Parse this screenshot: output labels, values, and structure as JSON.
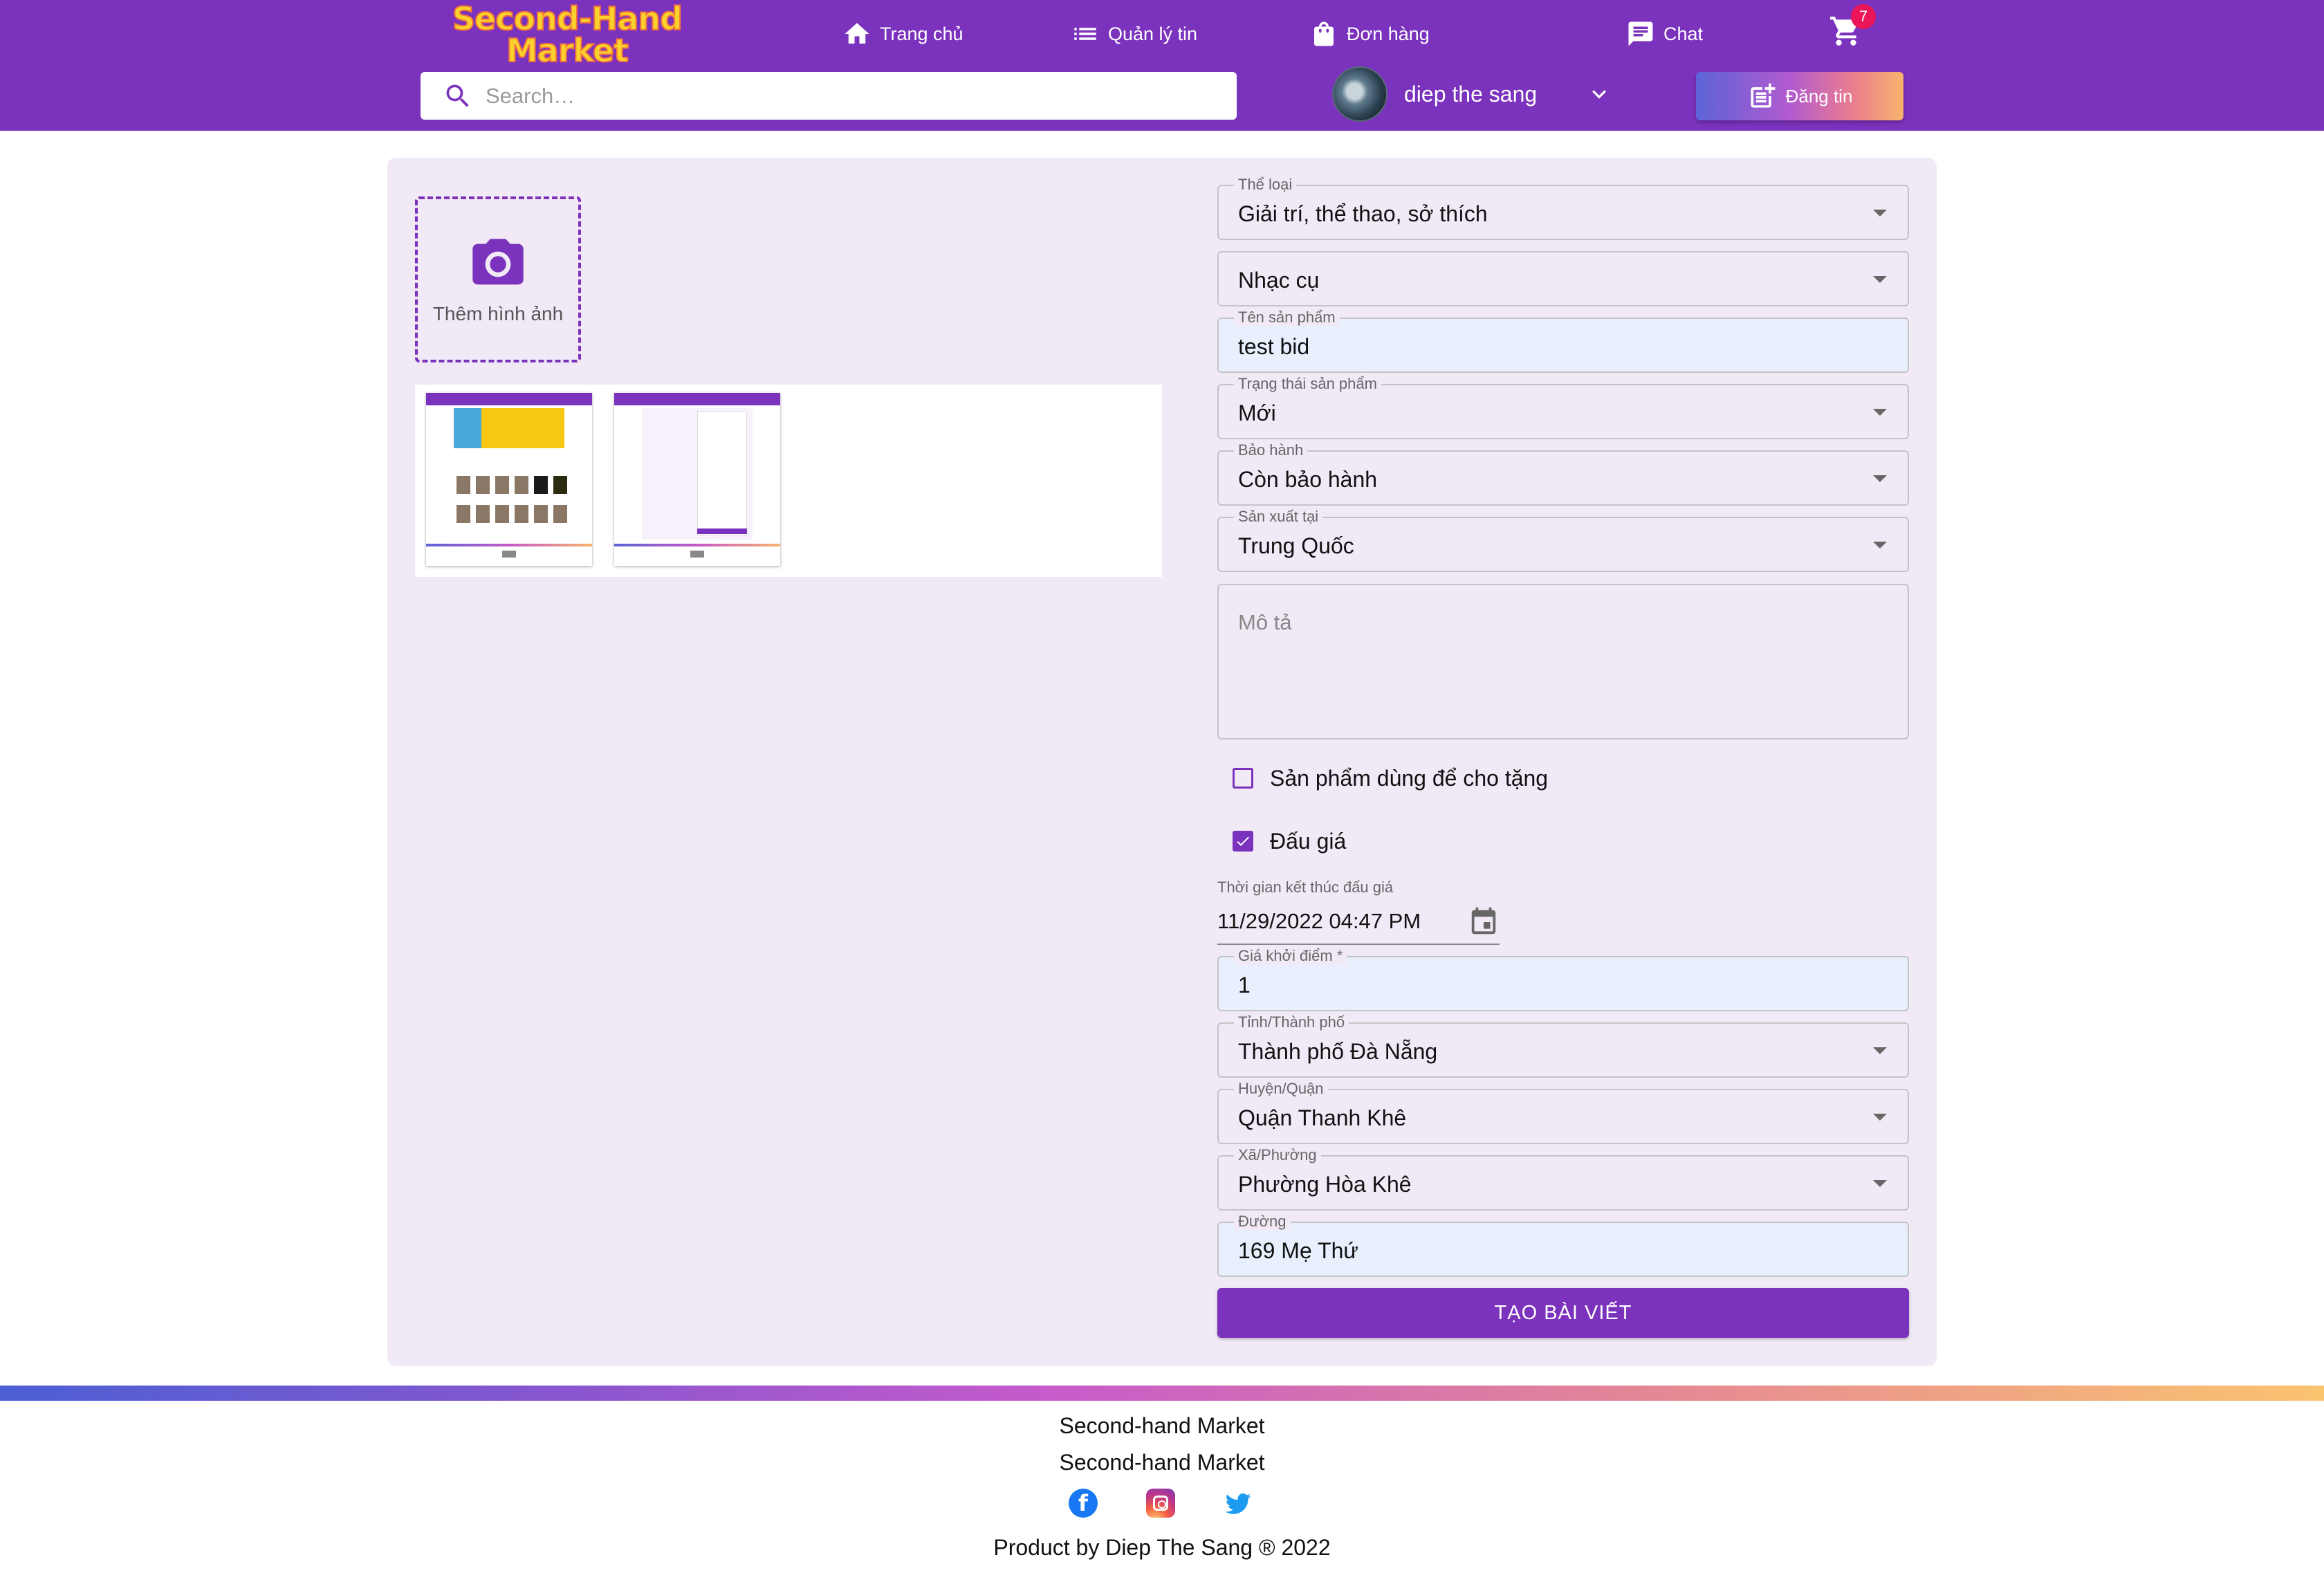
{
  "brand": {
    "logo_line1": "Second-Hand",
    "logo_line2": "Market",
    "primary_color": "#7b32bd"
  },
  "nav": {
    "home": "Trang chủ",
    "manage": "Quản lý tin",
    "orders": "Đơn hàng",
    "chat": "Chat",
    "cart_count": "7"
  },
  "search": {
    "placeholder": "Search…"
  },
  "user": {
    "name": "diep the sang"
  },
  "post_button": "Đăng tin",
  "upload": {
    "add_image_label": "Thêm hình ảnh",
    "thumbnail_count": 2
  },
  "form": {
    "category": {
      "label": "Thể loại",
      "value": "Giải trí, thể thao, sở thích"
    },
    "subcategory": {
      "value": "Nhạc cụ"
    },
    "product_name": {
      "label": "Tên sản phẩm",
      "value": "test bid"
    },
    "condition": {
      "label": "Trạng thái sản phẩm",
      "value": "Mới"
    },
    "warranty": {
      "label": "Bảo hành",
      "value": "Còn bảo hành"
    },
    "origin": {
      "label": "Sản xuất tại",
      "value": "Trung Quốc"
    },
    "description": {
      "placeholder": "Mô tả"
    },
    "donate": {
      "label": "Sản phẩm dùng để cho tặng",
      "checked": false
    },
    "auction": {
      "label": "Đấu giá",
      "checked": true
    },
    "auction_end": {
      "label": "Thời gian kết thúc đấu giá",
      "value": "11/29/2022 04:47 PM"
    },
    "start_price": {
      "label": "Giá khởi điểm *",
      "value": "1"
    },
    "city": {
      "label": "Tỉnh/Thành phố",
      "value": "Thành phố Đà Nẵng"
    },
    "district": {
      "label": "Huyện/Quận",
      "value": "Quận Thanh Khê"
    },
    "ward": {
      "label": "Xã/Phường",
      "value": "Phường Hòa Khê"
    },
    "street": {
      "label": "Đường",
      "value": "169 Mẹ Thứ"
    },
    "submit": "TẠO BÀI VIẾT"
  },
  "footer": {
    "name_1": "Second-hand Market",
    "name_2": "Second-hand Market",
    "credit": "Product by Diep The Sang ® 2022",
    "social": [
      "facebook-icon",
      "instagram-icon",
      "twitter-icon"
    ]
  }
}
